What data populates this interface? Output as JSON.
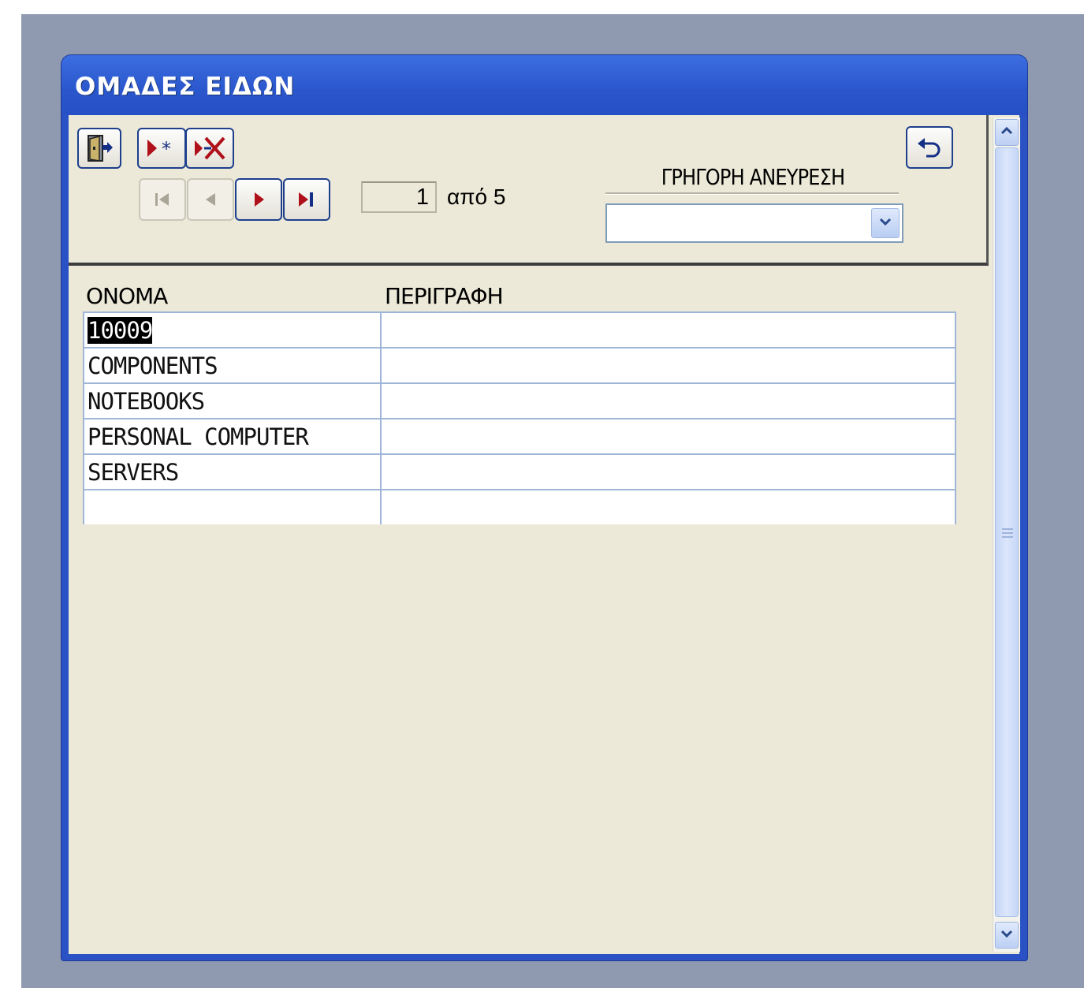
{
  "window": {
    "title": "ΟΜΑΔΕΣ ΕΙΔΩΝ"
  },
  "toolbar": {
    "buttons": [
      {
        "name": "exit",
        "icon": "exit-door-icon",
        "enabled": true
      },
      {
        "name": "new-record",
        "icon": "new-record-icon",
        "enabled": true
      },
      {
        "name": "delete-record",
        "icon": "delete-record-icon",
        "enabled": true
      },
      {
        "name": "undo",
        "icon": "undo-icon",
        "enabled": true
      }
    ],
    "navigation": [
      {
        "name": "first",
        "icon": "first-record-icon",
        "enabled": false
      },
      {
        "name": "previous",
        "icon": "previous-record-icon",
        "enabled": false
      },
      {
        "name": "next",
        "icon": "next-record-icon",
        "enabled": true
      },
      {
        "name": "last",
        "icon": "last-record-icon",
        "enabled": true
      }
    ],
    "record_current": "1",
    "record_of_label": "από  5"
  },
  "search": {
    "label": "ΓΡΗΓΟΡΗ ΑΝΕΥΡΕΣΗ",
    "value": ""
  },
  "grid": {
    "columns": [
      "ΟΝΟΜΑ",
      "ΠΕΡΙΓΡΑΦΗ"
    ],
    "rows": [
      [
        "10009",
        ""
      ],
      [
        "COMPONENTS",
        ""
      ],
      [
        "NOTEBOOKS",
        ""
      ],
      [
        "PERSONAL COMPUTER",
        ""
      ],
      [
        "SERVERS",
        ""
      ],
      [
        "",
        ""
      ]
    ]
  },
  "colors": {
    "titlebar": "#2a56cc",
    "client": "#ece9d8",
    "desktop": "#8f9ab0",
    "icon_red": "#b0101a",
    "icon_navy": "#142f86"
  }
}
